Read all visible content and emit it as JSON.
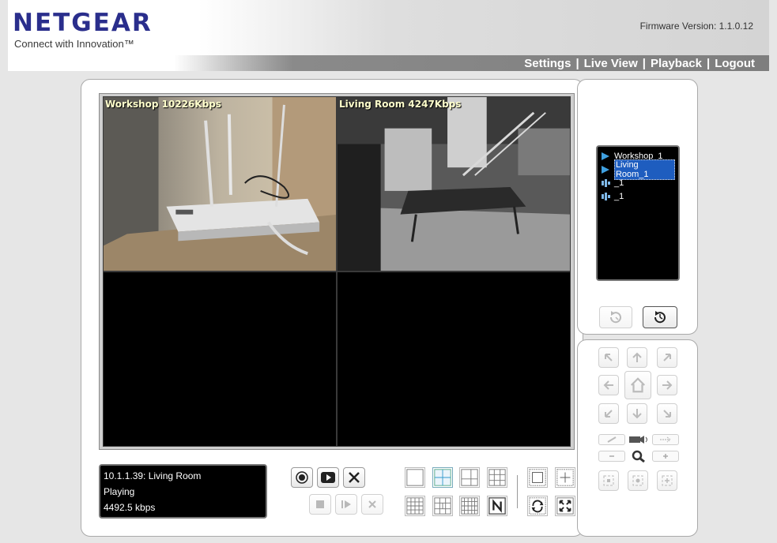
{
  "header": {
    "brand": "NETGEAR",
    "tagline": "Connect with Innovation™",
    "firmware": "Firmware Version: 1.1.0.12"
  },
  "nav": {
    "settings": "Settings",
    "live_view": "Live View",
    "playback": "Playback",
    "logout": "Logout",
    "separator": "|"
  },
  "cameras": {
    "cell1_label": "Workshop 10226Kbps",
    "cell2_label": "Living Room 4247Kbps"
  },
  "status": {
    "source": "10.1.1.39: Living Room",
    "state": "Playing",
    "bitrate": "4492.5 kbps"
  },
  "camera_list": {
    "items": [
      {
        "label": "Workshop_1",
        "icon": "play-icon"
      },
      {
        "label": "Living Room_1",
        "icon": "play-icon",
        "selected": true
      },
      {
        "label": "_1",
        "icon": "audio-icon"
      },
      {
        "label": "_1",
        "icon": "audio-icon"
      }
    ]
  },
  "colors": {
    "brand": "#2a2e8c",
    "label": "#ffffcc",
    "selection": "#1e5dbf"
  }
}
